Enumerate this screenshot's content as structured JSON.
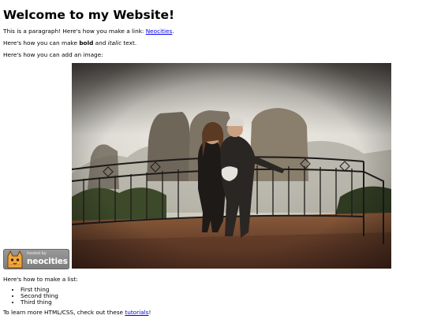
{
  "heading": "Welcome to my Website!",
  "intro": {
    "before": "This is a paragraph! Here's how you make a link: ",
    "link": "Neocities",
    "after": "."
  },
  "formatting": {
    "before": "Here's how you can make ",
    "bold": "bold",
    "middle": " and ",
    "italic": "italic",
    "after": " text."
  },
  "image_intro": "Here's how you can add an image:",
  "badge": {
    "small": "hosted by",
    "big": "neocities",
    "icon": "neocities-cat-icon"
  },
  "photo": {
    "icon": "couple-photo"
  },
  "list_intro": "Here's how to make a list:",
  "list_items": [
    "First thing",
    "Second thing",
    "Third thing"
  ],
  "outro": {
    "before": "To learn more HTML/CSS, check out these ",
    "link": "tutorials",
    "after": "!"
  },
  "colors": {
    "link": "#0000ee",
    "text": "#000000",
    "background": "#ffffff"
  }
}
